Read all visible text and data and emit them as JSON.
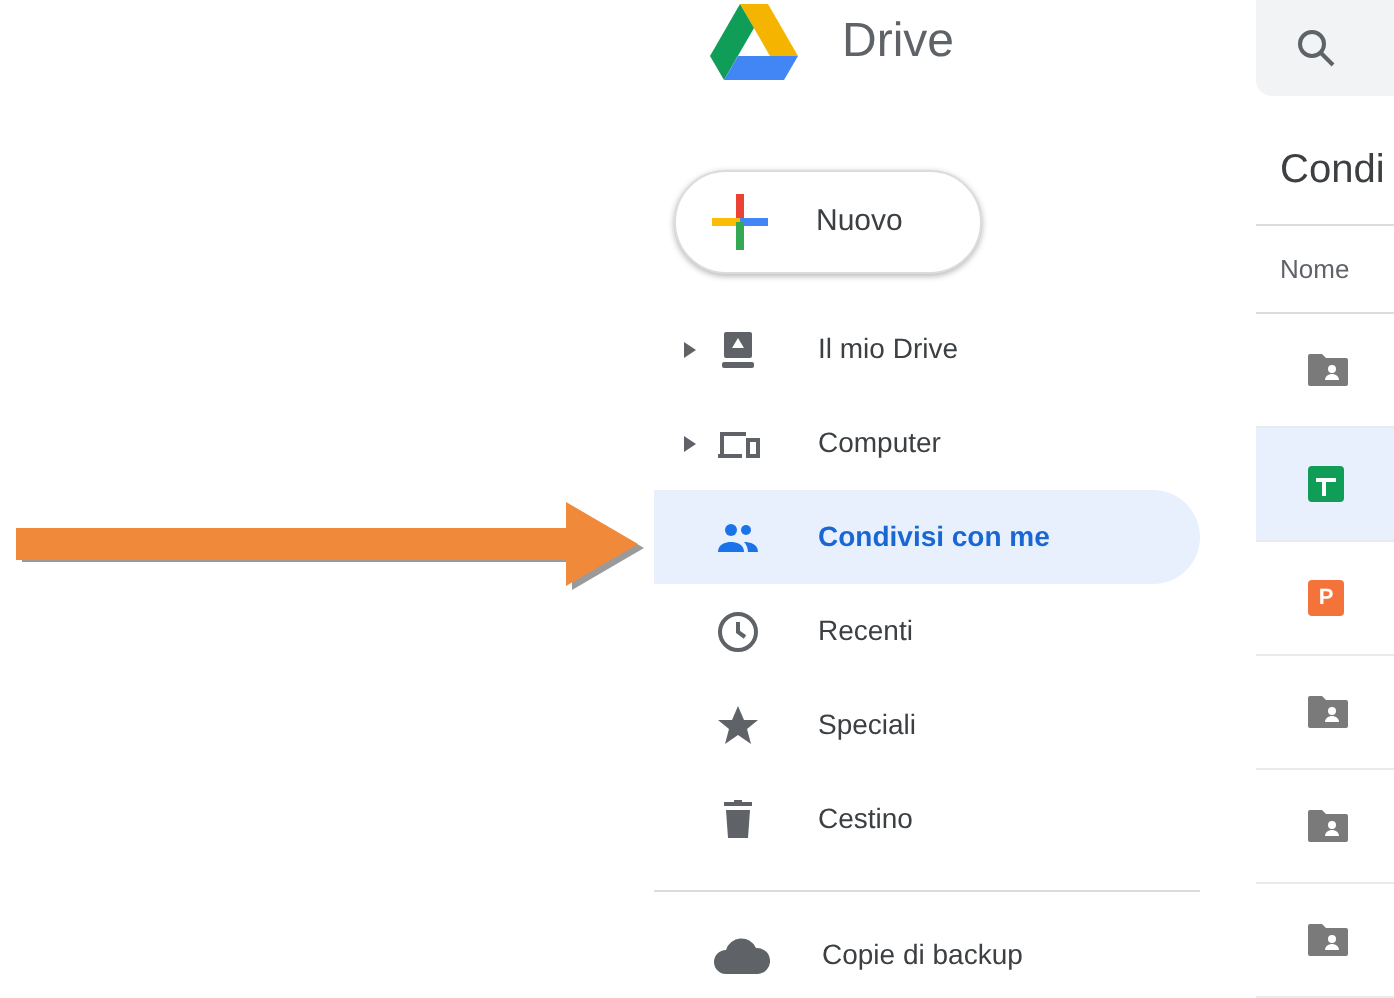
{
  "app": {
    "name": "Drive"
  },
  "new_button": {
    "label": "Nuovo"
  },
  "sidebar": {
    "items": [
      {
        "label": "Il mio Drive",
        "expandable": true,
        "selected": false
      },
      {
        "label": "Computer",
        "expandable": true,
        "selected": false
      },
      {
        "label": "Condivisi con me",
        "expandable": false,
        "selected": true
      },
      {
        "label": "Recenti",
        "expandable": false,
        "selected": false
      },
      {
        "label": "Speciali",
        "expandable": false,
        "selected": false
      },
      {
        "label": "Cestino",
        "expandable": false,
        "selected": false
      }
    ],
    "footer_items": [
      {
        "label": "Copie di backup"
      }
    ]
  },
  "main": {
    "title": "Condi",
    "column_header": "Nome",
    "rows": [
      {
        "kind": "shared-folder",
        "selected": false
      },
      {
        "kind": "spreadsheet",
        "selected": true
      },
      {
        "kind": "presentation",
        "icon_letter": "P",
        "selected": false
      },
      {
        "kind": "shared-folder",
        "selected": false
      },
      {
        "kind": "shared-folder",
        "selected": false
      },
      {
        "kind": "shared-folder",
        "selected": false
      }
    ]
  }
}
